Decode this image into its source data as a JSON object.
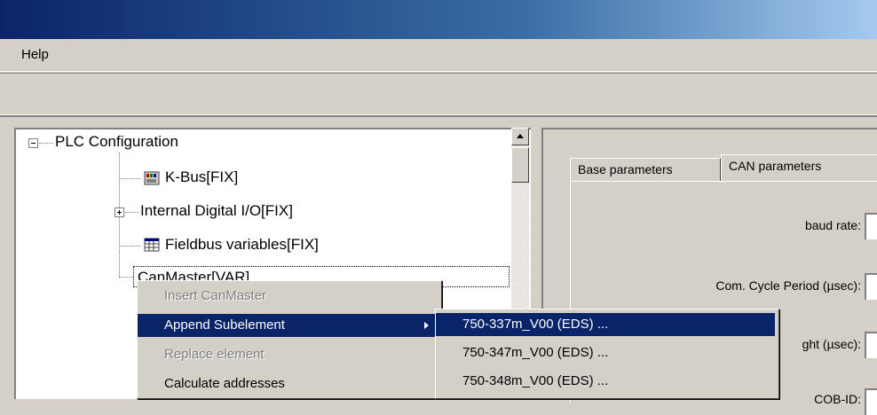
{
  "menubar": {
    "help_label": "Help"
  },
  "tree": {
    "root": "PLC Configuration",
    "items": [
      {
        "label": "K-Bus[FIX]",
        "icon": "module-icon"
      },
      {
        "label": "Internal Digital I/O[FIX]",
        "icon": "expand-icon"
      },
      {
        "label": "Fieldbus variables[FIX]",
        "icon": "grid-icon"
      },
      {
        "label": "CanMaster[VAR]"
      }
    ]
  },
  "tabs": {
    "base": "Base parameters",
    "can": "CAN parameters"
  },
  "fields": {
    "baud_rate": "baud rate:",
    "cycle_period": "Com. Cycle Period (µsec):",
    "sync_length": "ght (µsec):",
    "cob_id": "COB-ID:"
  },
  "context_menu": {
    "items": [
      {
        "label": "Insert CanMaster",
        "state": "disabled"
      },
      {
        "label": "Append Subelement",
        "state": "highlighted"
      },
      {
        "label": "Replace element",
        "state": "disabled"
      },
      {
        "label": "Calculate addresses",
        "state": "enabled"
      }
    ]
  },
  "submenu": {
    "items": [
      "750-337m_V00 (EDS) ...",
      "750-347m_V00 (EDS) ...",
      "750-348m_V00 (EDS) ..."
    ]
  },
  "colors": {
    "highlight": "#0a246a",
    "face": "#d4d0c8",
    "title_start": "#0a246a",
    "title_end": "#a6caf0"
  }
}
